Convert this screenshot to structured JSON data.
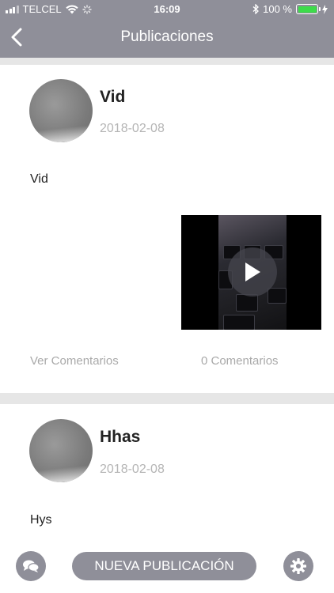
{
  "status_bar": {
    "carrier": "TELCEL",
    "time": "16:09",
    "battery": "100 %",
    "battery_level": 1.0
  },
  "header": {
    "title": "Publicaciones",
    "back_icon": "chevron-left-icon"
  },
  "posts": [
    {
      "title": "Vid",
      "date": "2018-02-08",
      "body": "Vid",
      "has_video": true,
      "view_comments": "Ver Comentarios",
      "comment_count": "0 Comentarios"
    },
    {
      "title": "Hhas",
      "date": "2018-02-08",
      "body": "Hys"
    }
  ],
  "bottom_bar": {
    "new_post_label": "NUEVA PUBLICACIÓN",
    "left_icon": "chat-bubbles-icon",
    "right_icon": "gear-icon"
  },
  "colors": {
    "header": "#8f8f99",
    "separator": "#e6e6e6",
    "date_text": "#b5b5b5",
    "link_text": "#a9a9a9"
  }
}
